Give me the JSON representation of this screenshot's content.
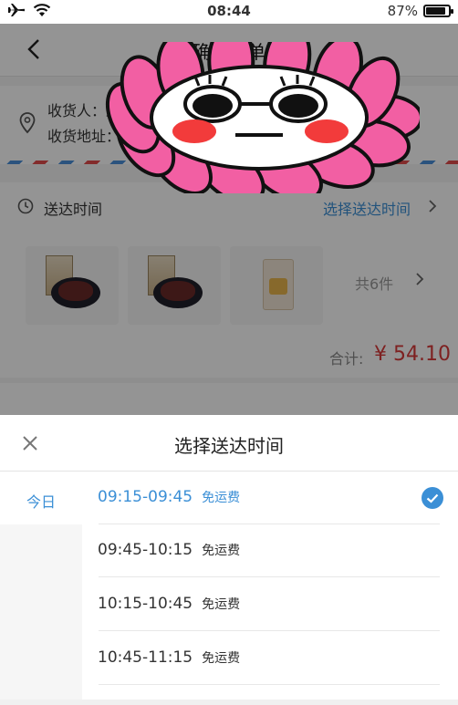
{
  "status_bar": {
    "time": "08:44",
    "battery_text": "87%",
    "battery_level": 0.87,
    "icons": [
      "airplane-icon",
      "wifi-icon",
      "battery-icon"
    ]
  },
  "nav": {
    "title": "确认订单"
  },
  "address": {
    "recipient_label": "收货人：王",
    "address_label": "收货地址："
  },
  "delivery": {
    "label": "送达时间",
    "pick_text": "选择送达时间"
  },
  "goods": {
    "count_text": "共6件"
  },
  "total": {
    "label": "合计:",
    "price": "¥ 54.10"
  },
  "sheet": {
    "title": "选择送达时间",
    "days": [
      {
        "label": "今日",
        "selected": true
      }
    ],
    "slots": [
      {
        "time": "09:15-09:45",
        "fee": "免运费",
        "selected": true
      },
      {
        "time": "09:45-10:15",
        "fee": "免运费",
        "selected": false
      },
      {
        "time": "10:15-10:45",
        "fee": "免运费",
        "selected": false
      },
      {
        "time": "10:45-11:15",
        "fee": "免运费",
        "selected": false
      }
    ]
  },
  "colors": {
    "accent": "#3b8fd6",
    "price": "#d93a3a",
    "sticker_petal": "#f25fa3"
  }
}
